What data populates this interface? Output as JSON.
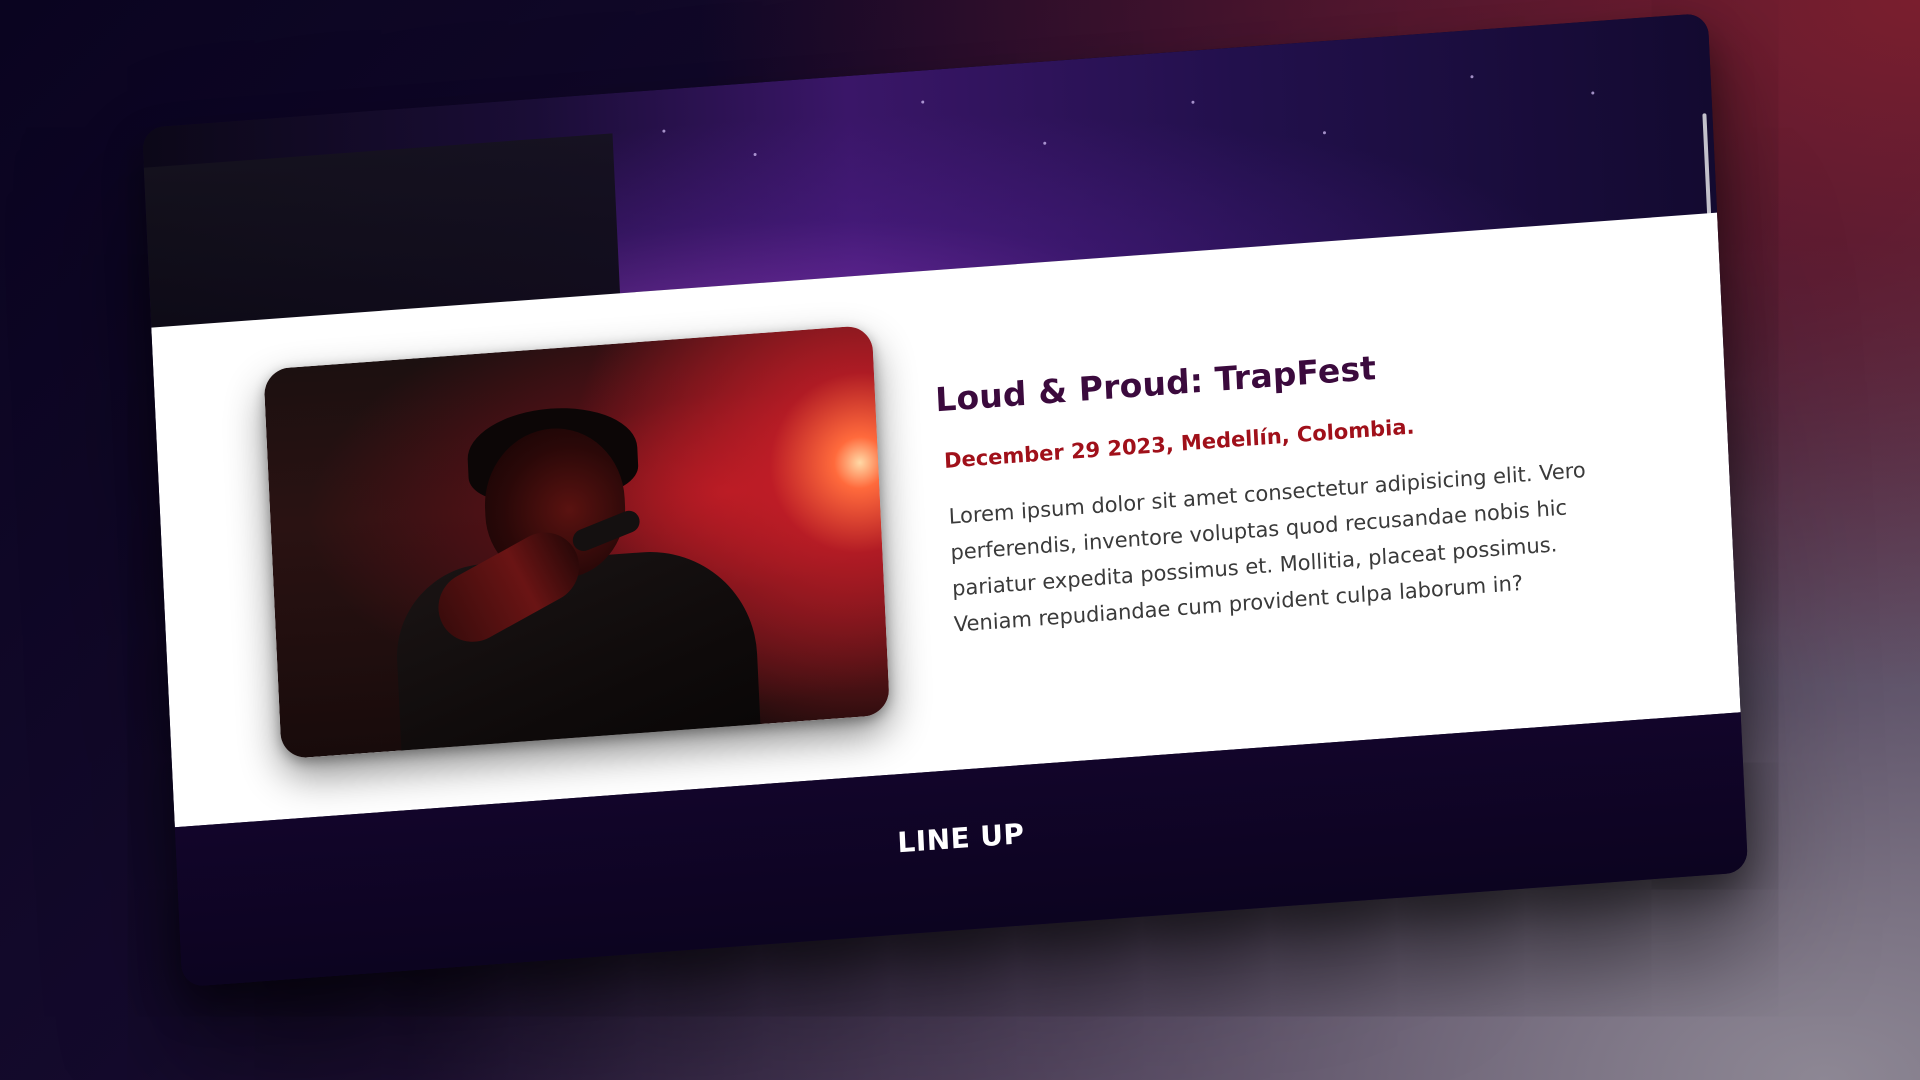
{
  "event": {
    "title": "Loud & Proud: TrapFest",
    "date_location": "December 29 2023, Medellín, Colombia.",
    "description": "Lorem ipsum dolor sit amet consectetur adipisicing elit. Vero perferendis, inventore voluptas quod recusandae nobis hic pariatur expedita possimus et. Mollitia, placeat possimus. Veniam repudiandae cum provident culpa laborum in?"
  },
  "lineup": {
    "title": "LINE UP"
  },
  "colors": {
    "title": "#3b0a3d",
    "date": "#a0101a",
    "footer_bg": "#12052a"
  }
}
